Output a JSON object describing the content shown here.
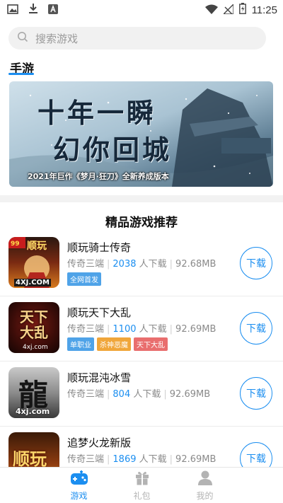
{
  "status_bar": {
    "time": "11:25"
  },
  "search": {
    "placeholder": "搜索游戏"
  },
  "section": {
    "title": "手游"
  },
  "banner": {
    "title_line1": "十年一瞬",
    "title_line2": "幻你回城",
    "subtitle": "2021年巨作《梦月·狂刀》全新养成版本"
  },
  "recommend": {
    "title": "精品游戏推荐"
  },
  "games": [
    {
      "name": "顺玩骑士传奇",
      "category": "传奇三端",
      "count": "2038",
      "count_suffix": "人下载",
      "size": "92.68MB",
      "tags": [
        {
          "label": "全网首发",
          "color": "#4fa3e8"
        }
      ],
      "button": "下载",
      "icon_text": "顺玩",
      "icon_sub": "4XJ.COM"
    },
    {
      "name": "顺玩天下大乱",
      "category": "传奇三端",
      "count": "1100",
      "count_suffix": "人下载",
      "size": "92.69MB",
      "tags": [
        {
          "label": "单职业",
          "color": "#4fa3e8"
        },
        {
          "label": "杀神恶魔",
          "color": "#f0a63a"
        },
        {
          "label": "天下大乱",
          "color": "#e96e6e"
        }
      ],
      "button": "下载",
      "icon_text": "天下大乱",
      "icon_sub": "4xj.com"
    },
    {
      "name": "顺玩混沌冰雪",
      "category": "传奇三端",
      "count": "804",
      "count_suffix": "人下载",
      "size": "92.69MB",
      "tags": [],
      "button": "下载",
      "icon_text": "龍",
      "icon_sub": "4xj.com"
    },
    {
      "name": "追梦火龙新版",
      "category": "传奇三端",
      "count": "1869",
      "count_suffix": "人下载",
      "size": "92.69MB",
      "tags": [],
      "button": "下载",
      "icon_text": "顺玩",
      "icon_sub": ""
    }
  ],
  "nav": {
    "items": [
      {
        "label": "游戏",
        "icon": "gamepad-icon",
        "active": true
      },
      {
        "label": "礼包",
        "icon": "gift-icon",
        "active": false
      },
      {
        "label": "我的",
        "icon": "user-icon",
        "active": false
      }
    ]
  },
  "colors": {
    "accent": "#1b8ef0",
    "tag_blue": "#4fa3e8",
    "tag_orange": "#f0a63a",
    "tag_red": "#e96e6e",
    "inactive": "#b3b3b3"
  }
}
